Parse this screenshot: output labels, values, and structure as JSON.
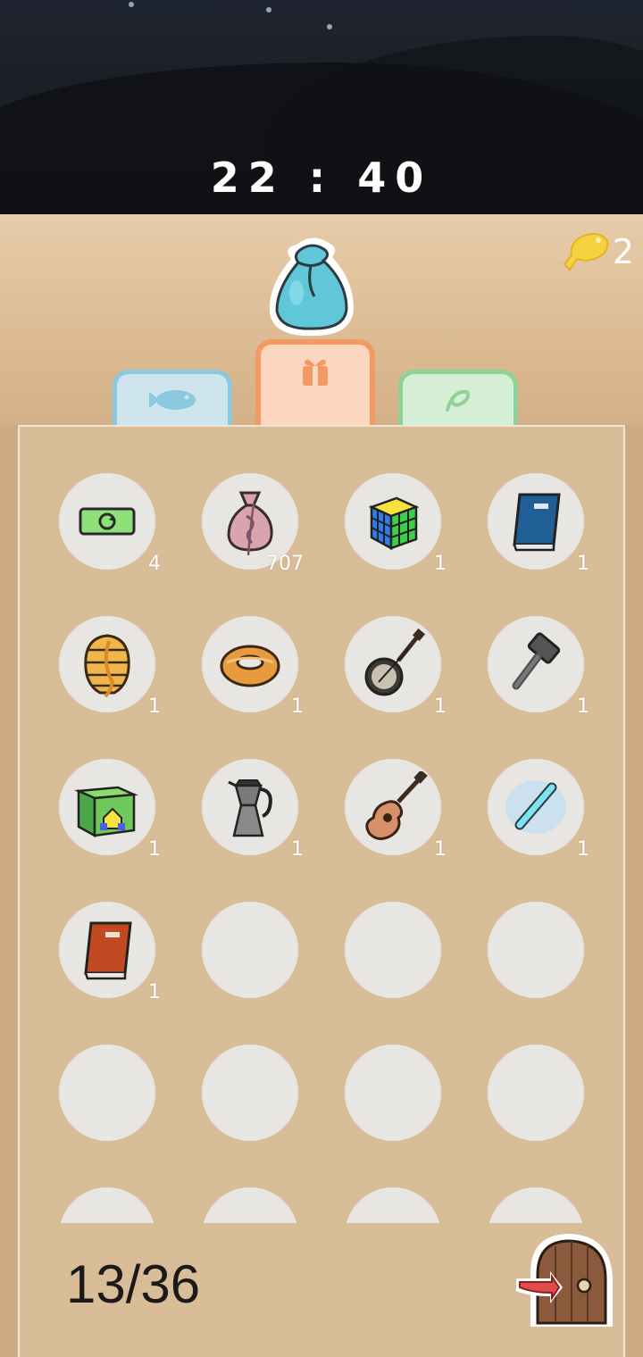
{
  "clock": {
    "time": "22 : 40"
  },
  "currency": {
    "icon": "fish-coin-icon",
    "value": "2"
  },
  "tabs": [
    {
      "name": "fish",
      "icon": "fish-icon",
      "color": "#8cc8de"
    },
    {
      "name": "items",
      "icon": "gift-box-icon",
      "color": "#f29a63",
      "active": true
    },
    {
      "name": "plants",
      "icon": "leaf-icon",
      "color": "#8fd197"
    }
  ],
  "inventory": {
    "capacity_text": "13/36",
    "items": [
      {
        "icon": "ticket-refresh-icon",
        "count": "4"
      },
      {
        "icon": "money-bag-icon",
        "count": "707"
      },
      {
        "icon": "rubiks-cube-icon",
        "count": "1"
      },
      {
        "icon": "blue-book-icon",
        "count": "1"
      },
      {
        "icon": "beehive-icon",
        "count": "1"
      },
      {
        "icon": "donut-icon",
        "count": "1"
      },
      {
        "icon": "banjo-icon",
        "count": "1"
      },
      {
        "icon": "hammer-icon",
        "count": "1"
      },
      {
        "icon": "green-box-icon",
        "count": "1"
      },
      {
        "icon": "moka-pot-icon",
        "count": "1"
      },
      {
        "icon": "guitar-icon",
        "count": "1"
      },
      {
        "icon": "glow-stick-icon",
        "count": "1"
      },
      {
        "icon": "red-book-icon",
        "count": "1"
      }
    ]
  },
  "exit_button": {
    "icon": "exit-door-icon"
  }
}
